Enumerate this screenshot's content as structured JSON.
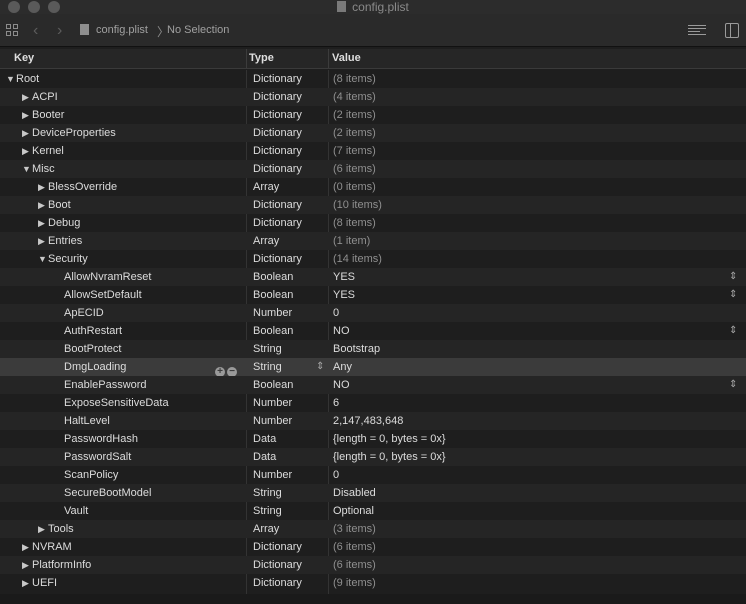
{
  "window": {
    "title": "config.plist"
  },
  "toolbar": {
    "path_file": "config.plist",
    "path_separator": "〉",
    "path_selection": "No Selection"
  },
  "header": {
    "key": "Key",
    "type": "Type",
    "value": "Value"
  },
  "rows": [
    {
      "key": "Root",
      "type": "Dictionary",
      "value": "(8 items)",
      "depth": 0,
      "expander": "open",
      "count": true
    },
    {
      "key": "ACPI",
      "type": "Dictionary",
      "value": "(4 items)",
      "depth": 1,
      "expander": "closed",
      "count": true
    },
    {
      "key": "Booter",
      "type": "Dictionary",
      "value": "(2 items)",
      "depth": 1,
      "expander": "closed",
      "count": true
    },
    {
      "key": "DeviceProperties",
      "type": "Dictionary",
      "value": "(2 items)",
      "depth": 1,
      "expander": "closed",
      "count": true
    },
    {
      "key": "Kernel",
      "type": "Dictionary",
      "value": "(7 items)",
      "depth": 1,
      "expander": "closed",
      "count": true
    },
    {
      "key": "Misc",
      "type": "Dictionary",
      "value": "(6 items)",
      "depth": 1,
      "expander": "open",
      "count": true
    },
    {
      "key": "BlessOverride",
      "type": "Array",
      "value": "(0 items)",
      "depth": 2,
      "expander": "closed",
      "count": true
    },
    {
      "key": "Boot",
      "type": "Dictionary",
      "value": "(10 items)",
      "depth": 2,
      "expander": "closed",
      "count": true
    },
    {
      "key": "Debug",
      "type": "Dictionary",
      "value": "(8 items)",
      "depth": 2,
      "expander": "closed",
      "count": true
    },
    {
      "key": "Entries",
      "type": "Array",
      "value": "(1 item)",
      "depth": 2,
      "expander": "closed",
      "count": true
    },
    {
      "key": "Security",
      "type": "Dictionary",
      "value": "(14 items)",
      "depth": 2,
      "expander": "open",
      "count": true
    },
    {
      "key": "AllowNvramReset",
      "type": "Boolean",
      "value": "YES",
      "depth": 3,
      "stepper": true
    },
    {
      "key": "AllowSetDefault",
      "type": "Boolean",
      "value": "YES",
      "depth": 3,
      "stepper": true
    },
    {
      "key": "ApECID",
      "type": "Number",
      "value": "0",
      "depth": 3
    },
    {
      "key": "AuthRestart",
      "type": "Boolean",
      "value": "NO",
      "depth": 3,
      "stepper": true
    },
    {
      "key": "BootProtect",
      "type": "String",
      "value": "Bootstrap",
      "depth": 3
    },
    {
      "key": "DmgLoading",
      "type": "String",
      "value": "Any",
      "depth": 3,
      "selected": true
    },
    {
      "key": "EnablePassword",
      "type": "Boolean",
      "value": "NO",
      "depth": 3,
      "stepper": true
    },
    {
      "key": "ExposeSensitiveData",
      "type": "Number",
      "value": "6",
      "depth": 3
    },
    {
      "key": "HaltLevel",
      "type": "Number",
      "value": "2,147,483,648",
      "depth": 3
    },
    {
      "key": "PasswordHash",
      "type": "Data",
      "value": "{length = 0, bytes = 0x}",
      "depth": 3
    },
    {
      "key": "PasswordSalt",
      "type": "Data",
      "value": "{length = 0, bytes = 0x}",
      "depth": 3
    },
    {
      "key": "ScanPolicy",
      "type": "Number",
      "value": "0",
      "depth": 3
    },
    {
      "key": "SecureBootModel",
      "type": "String",
      "value": "Disabled",
      "depth": 3
    },
    {
      "key": "Vault",
      "type": "String",
      "value": "Optional",
      "depth": 3
    },
    {
      "key": "Tools",
      "type": "Array",
      "value": "(3 items)",
      "depth": 2,
      "expander": "closed",
      "count": true
    },
    {
      "key": "NVRAM",
      "type": "Dictionary",
      "value": "(6 items)",
      "depth": 1,
      "expander": "closed",
      "count": true
    },
    {
      "key": "PlatformInfo",
      "type": "Dictionary",
      "value": "(6 items)",
      "depth": 1,
      "expander": "closed",
      "count": true
    },
    {
      "key": "UEFI",
      "type": "Dictionary",
      "value": "(9 items)",
      "depth": 1,
      "expander": "closed",
      "count": true
    }
  ]
}
